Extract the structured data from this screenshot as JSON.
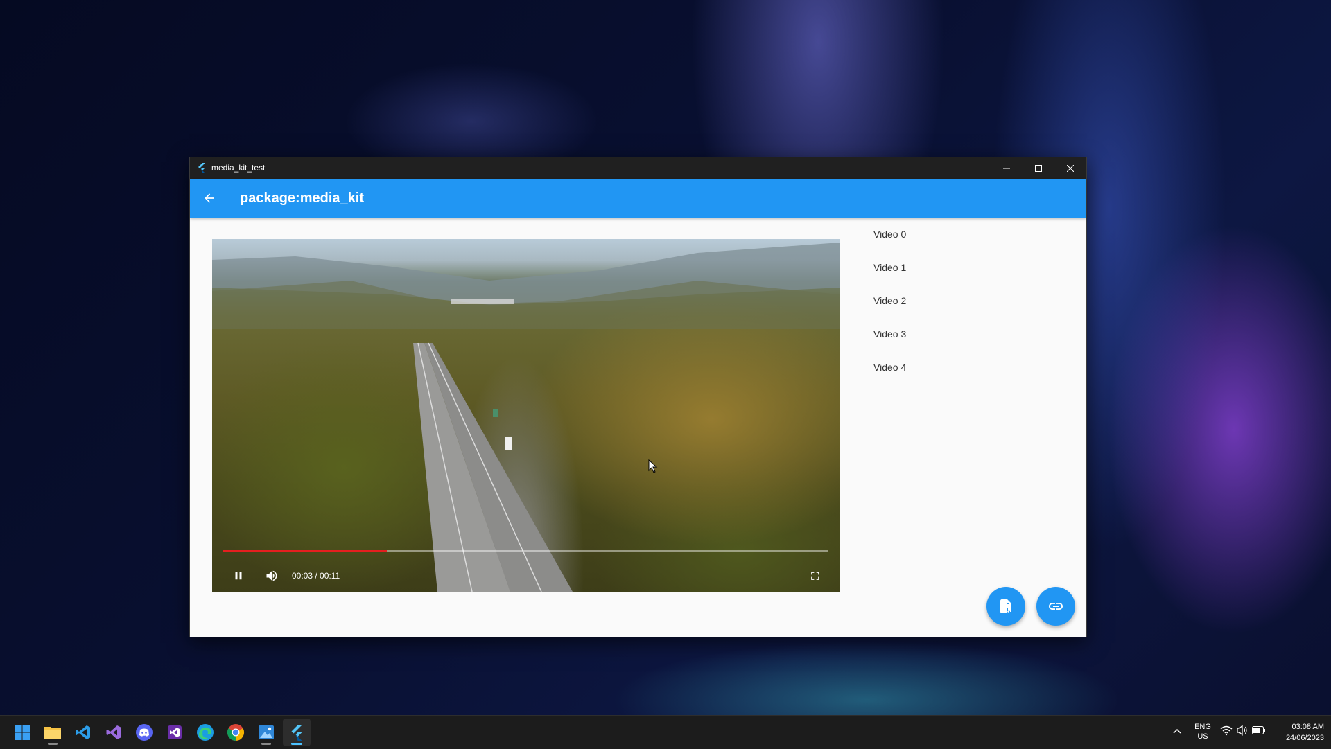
{
  "window": {
    "title": "media_kit_test",
    "controls": [
      "minimize-icon",
      "maximize-icon",
      "close-icon"
    ]
  },
  "appbar": {
    "back_icon": "arrow-back-icon",
    "title": "package:media_kit",
    "color": "#2196f3"
  },
  "player": {
    "time": "00:03 / 00:11",
    "progress": 0.27,
    "progress_color": "#e51f1f",
    "controls": [
      "pause-icon",
      "volume-icon",
      "fullscreen-icon"
    ]
  },
  "videos": [
    "Video 0",
    "Video 1",
    "Video 2",
    "Video 3",
    "Video 4"
  ],
  "fabs": [
    {
      "icon": "file-open-icon"
    },
    {
      "icon": "link-icon"
    }
  ],
  "taskbar": {
    "icons": [
      "windows-start-icon",
      "file-explorer-icon",
      "vscode-icon",
      "visual-studio-icon",
      "discord-icon",
      "visual-studio-preview-icon",
      "edge-icon",
      "chrome-icon",
      "photos-icon",
      "flutter-icon"
    ],
    "language_line1": "ENG",
    "language_line2": "US",
    "time": "03:08 AM",
    "date": "24/06/2023"
  }
}
